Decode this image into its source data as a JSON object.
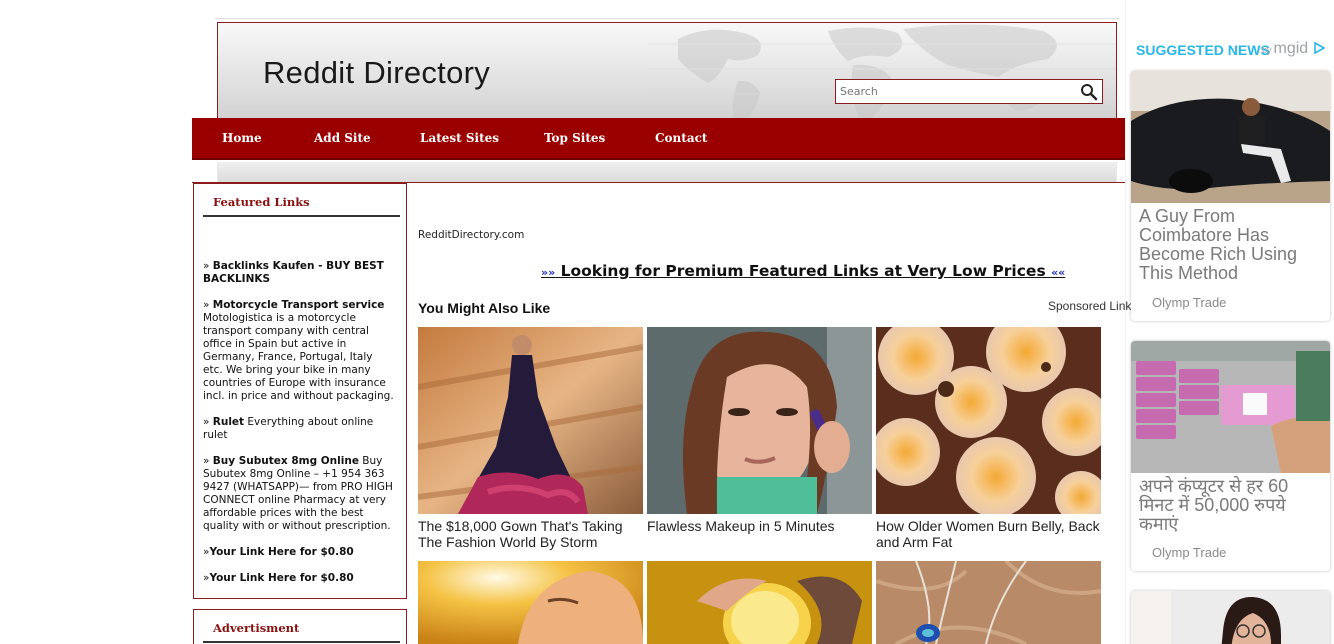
{
  "site": {
    "title": "Reddit Directory",
    "search_placeholder": "Search"
  },
  "nav": {
    "items": [
      {
        "label": "Home"
      },
      {
        "label": "Add Site"
      },
      {
        "label": "Latest Sites"
      },
      {
        "label": "Top Sites"
      },
      {
        "label": "Contact"
      }
    ]
  },
  "sidebar": {
    "featured_title": "Featured Links",
    "links": [
      {
        "prefix": "» ",
        "title": "Backlinks Kaufen - BUY BEST BACKLINKS",
        "desc": ""
      },
      {
        "prefix": "» ",
        "title": "Motorcycle Transport service",
        "desc": " Motologistica is a motorcycle transport company with central office in Spain but active in Germany, France, Portugal, Italy etc. We bring your bike in many countries of Europe with insurance incl. in price and without packaging."
      },
      {
        "prefix": "» ",
        "title": "Rulet",
        "desc": " Everything about online rulet"
      },
      {
        "prefix": "» ",
        "title": "Buy Subutex 8mg Online",
        "desc": " Buy Subutex 8mg Online – +1 954 363 9427 (WHATSAPP)— from PRO HIGH CONNECT online Pharmacy at very affordable prices with the best quality with or without prescription."
      },
      {
        "prefix": "»",
        "title": "Your Link Here for $0.80",
        "desc": ""
      },
      {
        "prefix": "»",
        "title": "Your Link Here for $0.80",
        "desc": ""
      }
    ],
    "advert_title": "Advertisment"
  },
  "main": {
    "domain": "RedditDirectory.com",
    "premium_prefix": "»»",
    "premium_text": " Looking for Premium Featured Links at Very Low Prices ",
    "premium_suffix": "««",
    "ymal_title": "You Might Also Like",
    "sponsored": "Sponsored Links",
    "cards": [
      {
        "text": "The $18,000 Gown That's Taking The Fashion World By Storm",
        "image": "gown-photo"
      },
      {
        "text": "Flawless Makeup in 5 Minutes",
        "image": "makeup-photo"
      },
      {
        "text": "How Older Women Burn Belly, Back and Arm Fat",
        "image": "cells-photo"
      },
      {
        "text": "",
        "image": "sun-face-photo"
      },
      {
        "text": "",
        "image": "lemon-photo"
      },
      {
        "text": "",
        "image": "necklace-photo"
      }
    ]
  },
  "widget": {
    "heading": "SUGGESTED NEWS",
    "by": "by",
    "brand": "mgid",
    "ads": [
      {
        "title": "A Guy From Coimbatore Has Become Rich Using This Method",
        "source": "Olymp Trade",
        "image": "car-man-photo"
      },
      {
        "title": "अपने कंप्यूटर से हर 60 मिनट में 50,000 रुपये कमाएं",
        "source": "Olymp Trade",
        "image": "money-photo"
      },
      {
        "title": "",
        "source": "",
        "image": "woman-phone-photo"
      }
    ]
  },
  "colors": {
    "nav_bg": "#9b0000",
    "accent_border": "#8a1c1c",
    "widget_accent": "#29b7ea"
  }
}
